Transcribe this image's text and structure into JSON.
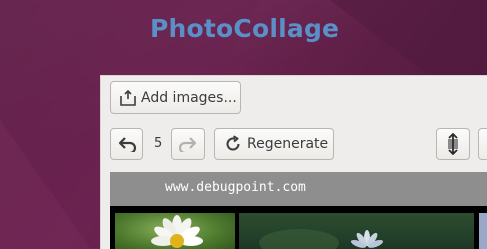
{
  "app": {
    "title": "PhotoCollage"
  },
  "toolbar": {
    "add_images_label": "Add images...",
    "history_count": "5",
    "regenerate_label": "Regenerate"
  },
  "canvas": {
    "watermark": "www.debugpoint.com"
  },
  "icons": {
    "add": "add-image-icon",
    "undo": "undo-icon",
    "redo": "redo-icon",
    "regenerate": "refresh-icon",
    "swap": "swap-vertical-icon"
  },
  "colors": {
    "title": "#5b8fc8",
    "desktop": "#6b2450",
    "window": "#efedeb",
    "banner": "#8e8e8e"
  }
}
